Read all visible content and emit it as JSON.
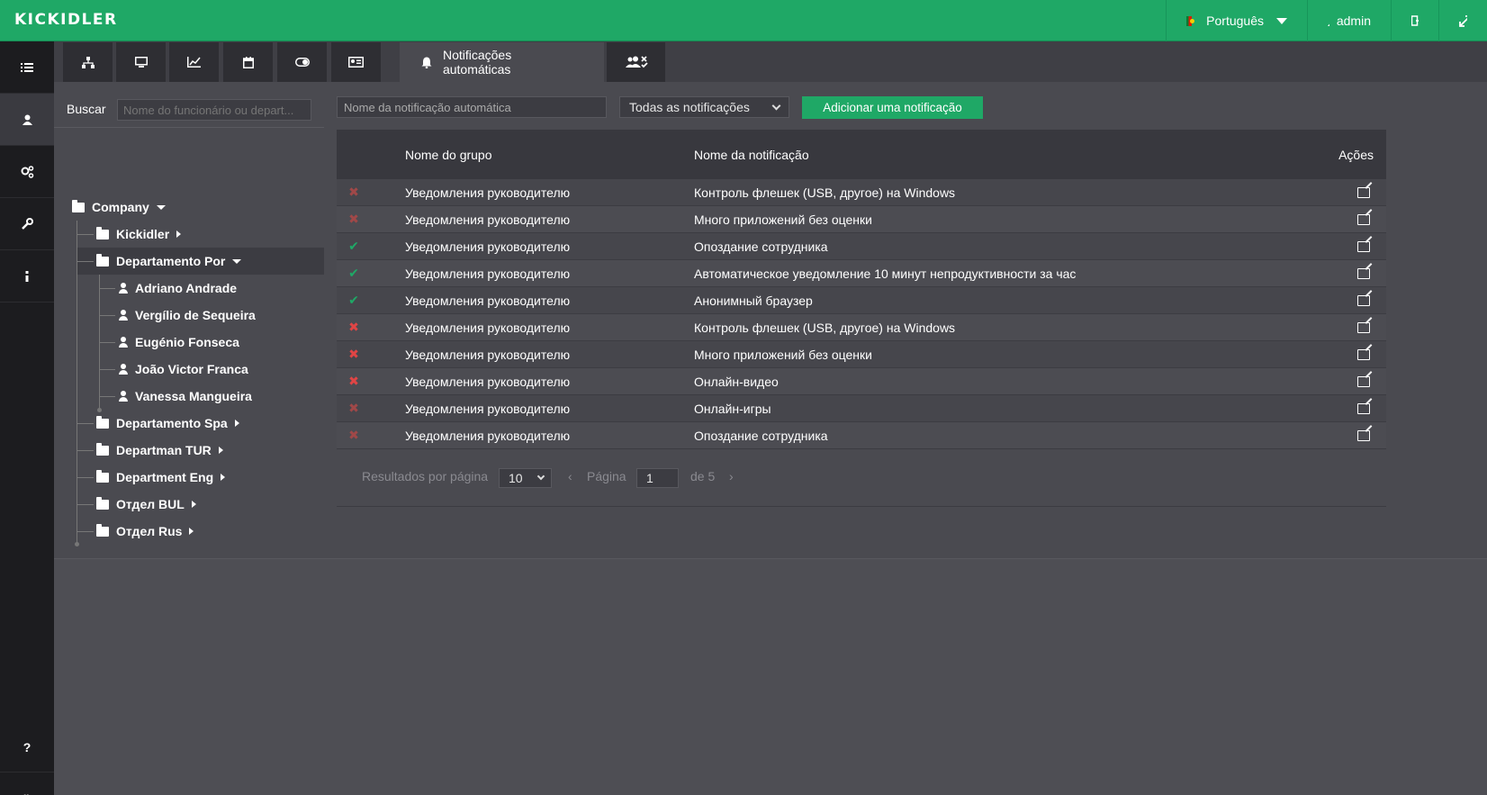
{
  "app": {
    "logo": "KICKIDLER"
  },
  "topbar": {
    "language": "Português",
    "user": "admin"
  },
  "sidebar": {
    "items": [
      "list-icon",
      "user-icon",
      "gears-icon",
      "wrench-icon",
      "info-icon"
    ],
    "bottom": [
      "?",
      "»"
    ]
  },
  "tabs": {
    "active_label": "Notificações automáticas",
    "icons": [
      "sitemap-icon",
      "monitor-icon",
      "chart-icon",
      "calendar-icon",
      "toggle-icon",
      "id-card-icon",
      "bell-icon",
      "users-x-icon"
    ]
  },
  "tree": {
    "search_label": "Buscar",
    "search_placeholder": "Nome do funcionário ou depart...",
    "root": "Company",
    "nodes": [
      {
        "label": "Kickidler",
        "type": "folder"
      },
      {
        "label": "Departamento Por",
        "type": "folder-open"
      },
      {
        "label": "Adriano Andrade",
        "type": "person"
      },
      {
        "label": "Vergílio de Sequeira",
        "type": "person"
      },
      {
        "label": "Eugénio Fonseca",
        "type": "person"
      },
      {
        "label": "João Victor Franca",
        "type": "person"
      },
      {
        "label": "Vanessa Mangueira",
        "type": "person"
      },
      {
        "label": "Departamento Spa",
        "type": "folder"
      },
      {
        "label": "Departman TUR",
        "type": "folder"
      },
      {
        "label": "Department Eng",
        "type": "folder"
      },
      {
        "label": "Отдел BUL",
        "type": "folder"
      },
      {
        "label": "Отдел Rus",
        "type": "folder"
      }
    ]
  },
  "filters": {
    "notif_placeholder": "Nome da notificação automática",
    "type_select": "Todas as notificações",
    "add_button": "Adicionar uma notificação"
  },
  "table": {
    "headers": {
      "group": "Nome do grupo",
      "name": "Nome da notificação",
      "actions": "Ações"
    },
    "rows": [
      {
        "status": "off-faded",
        "group": "Уведомления руководителю",
        "name": "Контроль флешек (USB, другое) на Windows"
      },
      {
        "status": "off-faded",
        "group": "Уведомления руководителю",
        "name": "Много приложений без оценки"
      },
      {
        "status": "on",
        "group": "Уведомления руководителю",
        "name": "Опоздание сотрудника"
      },
      {
        "status": "on",
        "group": "Уведомления руководителю",
        "name": "Автоматическое уведомление 10 минут непродуктивности за час"
      },
      {
        "status": "on",
        "group": "Уведомления руководителю",
        "name": "Анонимный браузер"
      },
      {
        "status": "off",
        "group": "Уведомления руководителю",
        "name": "Контроль флешек (USB, другое) на Windows"
      },
      {
        "status": "off",
        "group": "Уведомления руководителю",
        "name": "Много приложений без оценки"
      },
      {
        "status": "off",
        "group": "Уведомления руководителю",
        "name": "Онлайн-видео"
      },
      {
        "status": "off-faded",
        "group": "Уведомления руководителю",
        "name": "Онлайн-игры"
      },
      {
        "status": "off-faded",
        "group": "Уведомления руководителю",
        "name": "Опоздание сотрудника"
      }
    ]
  },
  "pager": {
    "per_page_label": "Resultados por página",
    "per_page": "10",
    "prev": "‹",
    "page_label": "Página",
    "page": "1",
    "of": "de 5",
    "next": "›"
  },
  "colors": {
    "accent": "#1fa866",
    "check": "#1fa866",
    "cross": "#e04545",
    "cross_faded": "#a04848"
  }
}
